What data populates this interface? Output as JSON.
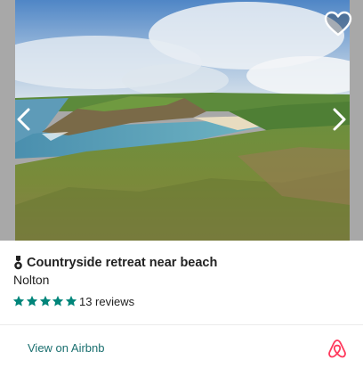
{
  "listing": {
    "title": "Countryside retreat near beach",
    "location": "Nolton",
    "rating_stars": 5,
    "reviews_text": "13 reviews"
  },
  "footer": {
    "link_label": "View on Airbnb"
  },
  "icons": {
    "award": "award-icon",
    "favorite": "heart-icon",
    "previous": "chevron-left-icon",
    "next": "chevron-right-icon",
    "star": "star-icon",
    "brand": "airbnb-logo-icon"
  },
  "colors": {
    "star": "#00857a",
    "link": "#1a6f6f",
    "brand": "#ff385c",
    "text": "#222222"
  }
}
